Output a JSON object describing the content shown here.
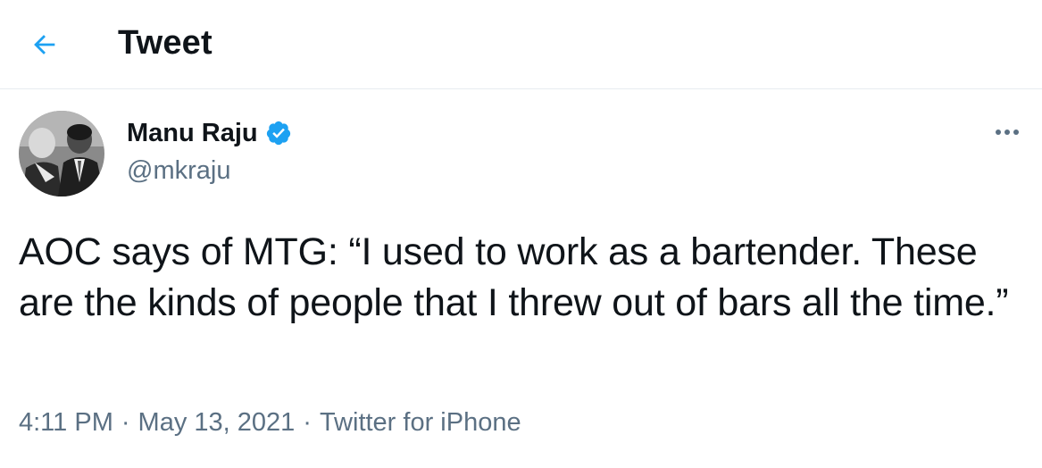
{
  "header": {
    "back_icon": "arrow-left-icon",
    "title": "Tweet"
  },
  "tweet": {
    "author": {
      "display_name": "Manu Raju",
      "handle": "@mkraju",
      "verified": true,
      "avatar": "avatar-photo"
    },
    "more_icon": "more-horizontal-icon",
    "text": "AOC says of MTG: “I used to work as a bartender. These are the kinds of people that I threw out of bars all the time.”",
    "meta": {
      "time": "4:11 PM",
      "separator": "·",
      "date": "May 13, 2021",
      "source": "Twitter for iPhone"
    }
  },
  "colors": {
    "accent": "#1da1f2",
    "text_primary": "#0f1419",
    "text_secondary": "#5b7083",
    "divider": "#e6ecf0"
  }
}
